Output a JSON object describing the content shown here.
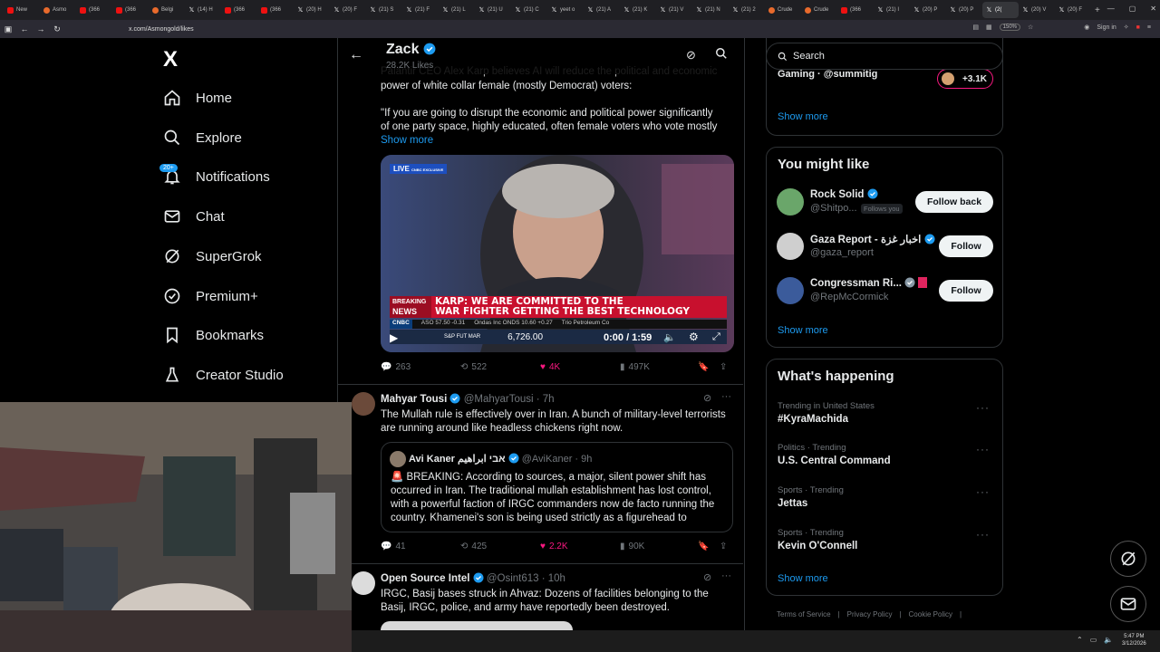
{
  "browser": {
    "tabs": [
      {
        "label": "New",
        "icon": "yt"
      },
      {
        "label": "Asmo",
        "icon": "org"
      },
      {
        "label": "(366",
        "icon": "yt"
      },
      {
        "label": "(366",
        "icon": "yt"
      },
      {
        "label": "Belgi",
        "icon": "org"
      },
      {
        "label": "(14) H",
        "icon": "x"
      },
      {
        "label": "(366",
        "icon": "yt"
      },
      {
        "label": "(366",
        "icon": "yt"
      },
      {
        "label": "(20) H",
        "icon": "x"
      },
      {
        "label": "(20) F",
        "icon": "x"
      },
      {
        "label": "(21) S",
        "icon": "x"
      },
      {
        "label": "(21) F",
        "icon": "x"
      },
      {
        "label": "(21) L",
        "icon": "x"
      },
      {
        "label": "(21) U",
        "icon": "x"
      },
      {
        "label": "(21) C",
        "icon": "x"
      },
      {
        "label": "yeet o",
        "icon": "x"
      },
      {
        "label": "(21) A",
        "icon": "x"
      },
      {
        "label": "(21) K",
        "icon": "x"
      },
      {
        "label": "(21) V",
        "icon": "x"
      },
      {
        "label": "(21) N",
        "icon": "x"
      },
      {
        "label": "(21) 2",
        "icon": "x"
      },
      {
        "label": "Crude",
        "icon": "org"
      },
      {
        "label": "Crude",
        "icon": "org"
      },
      {
        "label": "(366",
        "icon": "yt"
      },
      {
        "label": "(21) I",
        "icon": "x"
      },
      {
        "label": "(20) P",
        "icon": "x"
      },
      {
        "label": "(20) P",
        "icon": "x"
      },
      {
        "label": "(2(",
        "icon": "x",
        "active": true
      },
      {
        "label": "(20) V",
        "icon": "x"
      },
      {
        "label": "(20) F",
        "icon": "x"
      }
    ],
    "url": "x.com/Asmongold/likes",
    "zoom": "150%",
    "sign_in": "Sign in"
  },
  "nav": {
    "logo": "X",
    "items": [
      {
        "label": "Home",
        "icon": "home-icon"
      },
      {
        "label": "Explore",
        "icon": "search-icon"
      },
      {
        "label": "Notifications",
        "icon": "bell-icon"
      },
      {
        "label": "Chat",
        "icon": "mail-icon"
      },
      {
        "label": "SuperGrok",
        "icon": "grok-icon"
      },
      {
        "label": "Premium+",
        "icon": "verified-icon"
      },
      {
        "label": "Bookmarks",
        "icon": "bookmark-icon"
      },
      {
        "label": "Creator Studio",
        "icon": "flask-icon"
      }
    ],
    "notifications_badge": "20+"
  },
  "header": {
    "name": "Zack",
    "likes": "28.2K Likes"
  },
  "post1": {
    "line1": "Palantir CEO Alex Karp believes AI will reduce the political and economic",
    "line2": "power of white collar female (mostly Democrat) voters:",
    "line3": "\"If  you are going to disrupt the economic and political power significantly",
    "line4": "of one party space, highly educated, often female voters who vote mostly",
    "show_more": "Show more",
    "video": {
      "live": "LIVE",
      "exclusive": "CNBC EXCLUSIVE",
      "breaking": "BREAKING",
      "news": "NEWS",
      "headline1": "KARP: WE ARE COMMITTED TO THE",
      "headline2": "WAR FIGHTER GETTING THE BEST TECHNOLOGY",
      "network": "CNBC",
      "ticker1": "ASO 57.50 -0.31",
      "ticker2": "Ondas Inc ONDS 10.60 +0.27",
      "ticker3": "Trio Petroleum Co",
      "index_label": "S&P FUT MAR",
      "index_value": "6,726.00",
      "time": "0:00 / 1:59"
    },
    "replies": "263",
    "reposts": "522",
    "likes": "4K",
    "views": "497K"
  },
  "post2": {
    "name": "Mahyar Tousi",
    "handle": "@MahyarTousi · 7h",
    "line1": "The Mullah rule is effectively over in Iran. A bunch of military-level terrorists",
    "line2": "are running around like headless chickens right now.",
    "quote": {
      "name": "Avi Kaner אבי ابراهيم",
      "handle": "@AviKaner · 9h",
      "line1": "🚨 BREAKING: According to sources, a major, silent power shift has",
      "line2": "occurred in Iran. The traditional mullah establishment has lost control,",
      "line3": "with a powerful faction of IRGC commanders now de facto running the",
      "line4": "country. Khamenei's son is being used strictly as a figurehead to"
    },
    "replies": "41",
    "reposts": "425",
    "likes": "2.2K",
    "views": "90K"
  },
  "post3": {
    "name": "Open Source Intel",
    "handle": "@Osint613 · 10h",
    "line1": "IRGC, Basij bases struck in Ahvaz: Dozens of facilities belonging to the",
    "line2": "Basij, IRGC, police, and army have reportedly been destroyed."
  },
  "right": {
    "search_placeholder": "Search",
    "top_card": {
      "partial_text": "Gaming · @summitig",
      "count": "+3.1K",
      "show_more": "Show more"
    },
    "you_might_like": {
      "title": "You might like",
      "people": [
        {
          "name": "Rock Solid",
          "handle": "@Shitpo...",
          "follows_you": "Follows you",
          "button": "Follow back"
        },
        {
          "name": "Gaza Report - اخبار غزة",
          "handle": "@gaza_report",
          "button": "Follow"
        },
        {
          "name": "Congressman Ri...",
          "handle": "@RepMcCormick",
          "button": "Follow"
        }
      ],
      "show_more": "Show more"
    },
    "whats_happening": {
      "title": "What's happening",
      "trends": [
        {
          "meta": "Trending in United States",
          "name": "#KyraMachida"
        },
        {
          "meta": "Politics · Trending",
          "name": "U.S. Central Command"
        },
        {
          "meta": "Sports · Trending",
          "name": "Jettas"
        },
        {
          "meta": "Sports · Trending",
          "name": "Kevin O'Connell"
        }
      ],
      "show_more": "Show more"
    },
    "footer": [
      "Terms of Service",
      "Privacy Policy",
      "Cookie Policy"
    ]
  },
  "taskbar": {
    "time": "5:47 PM",
    "date": "3/12/2026"
  },
  "colors": {
    "accent": "#1d9bf0",
    "like": "#f91880",
    "muted": "#71767b",
    "border": "#2f3336"
  }
}
